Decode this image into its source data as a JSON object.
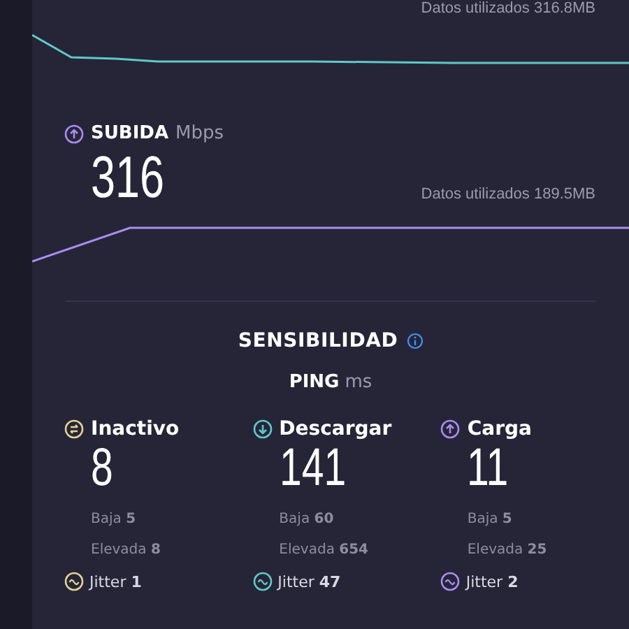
{
  "download_section": {
    "data_used": "Datos utilizados 316.8MB"
  },
  "upload_section": {
    "title": "SUBIDA",
    "unit": "Mbps",
    "value": "316",
    "data_used": "Datos utilizados 189.5MB"
  },
  "responsiveness": {
    "title": "SENSIBILIDAD",
    "ping_label": "PING",
    "ping_unit": "ms",
    "columns": [
      {
        "kind": "idle",
        "color": "#e4d197",
        "label": "Inactivo",
        "value": "8",
        "low": "Baja **5**",
        "high": "Elevada **8**",
        "jitter": "Jitter **1**"
      },
      {
        "kind": "download",
        "color": "#5fc9c9",
        "label": "Descargar",
        "value": "141",
        "low": "Baja **60**",
        "high": "Elevada **654**",
        "jitter": "Jitter **47**"
      },
      {
        "kind": "upload",
        "color": "#a98cf0",
        "label": "Carga",
        "value": "11",
        "low": "Baja **5**",
        "high": "Elevada **25**",
        "jitter": "Jitter **2**"
      }
    ]
  }
}
